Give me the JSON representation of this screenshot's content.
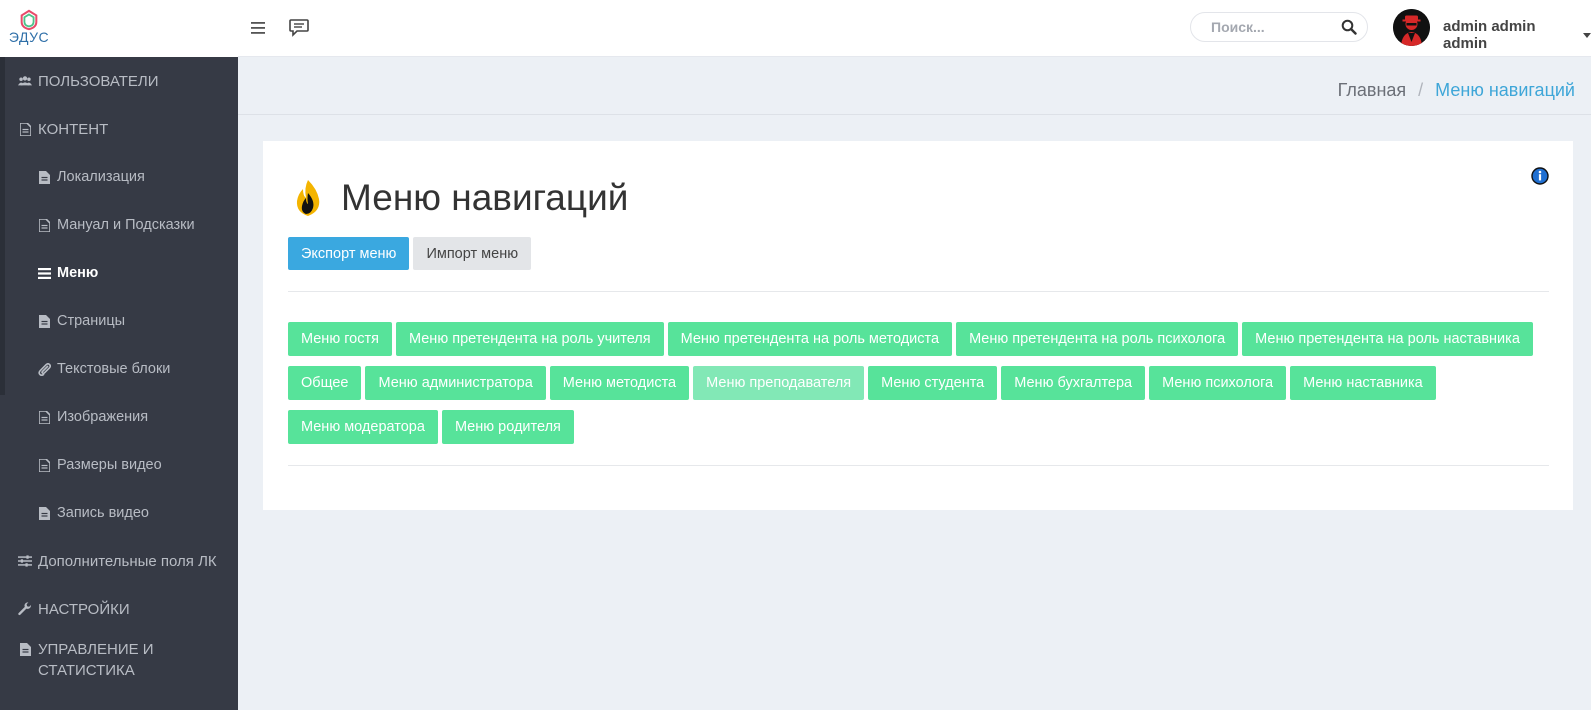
{
  "logo": {
    "text": "ЭДУС"
  },
  "sidebar": {
    "items": [
      {
        "label": "ПОЛЬЗОВАТЕЛИ",
        "icon": "users-icon"
      },
      {
        "label": "КОНТЕНТ",
        "icon": "file-icon"
      },
      {
        "label": "Локализация",
        "icon": "file-icon"
      },
      {
        "label": "Мануал и Подсказки",
        "icon": "file-icon"
      },
      {
        "label": "Меню",
        "icon": "bars-icon",
        "active": true
      },
      {
        "label": "Страницы",
        "icon": "file-icon"
      },
      {
        "label": "Текстовые блоки",
        "icon": "paperclip-icon"
      },
      {
        "label": "Изображения",
        "icon": "file-icon"
      },
      {
        "label": "Размеры видео",
        "icon": "file-icon"
      },
      {
        "label": "Запись видео",
        "icon": "file-icon"
      },
      {
        "label": "Дополнительные поля ЛК",
        "icon": "sliders-icon"
      },
      {
        "label": "НАСТРОЙКИ",
        "icon": "wrench-icon"
      },
      {
        "label": "УПРАВЛЕНИЕ И СТАТИСТИКА",
        "icon": "file-icon"
      }
    ]
  },
  "header": {
    "search_placeholder": "Поиск...",
    "user_name": "admin admin admin"
  },
  "breadcrumb": {
    "home": "Главная",
    "separator": "/",
    "current": "Меню навигаций"
  },
  "page": {
    "title": "Меню навигаций",
    "export_label": "Экспорт меню",
    "import_label": "Импорт меню"
  },
  "menus": [
    "Меню гостя",
    "Меню претендента на роль учителя",
    "Меню претендента на роль методиста",
    "Меню претендента на роль психолога",
    "Меню претендента на роль наставника",
    "Общее",
    "Меню администратора",
    "Меню методиста",
    "Меню преподавателя",
    "Меню студента",
    "Меню бухгалтера",
    "Меню психолога",
    "Меню наставника",
    "Меню модератора",
    "Меню родителя"
  ],
  "colors": {
    "sidebar_bg": "#363a45",
    "menu_button": "#57e39a",
    "primary": "#3aa8e0",
    "breadcrumb_active": "#3ea6d8"
  }
}
